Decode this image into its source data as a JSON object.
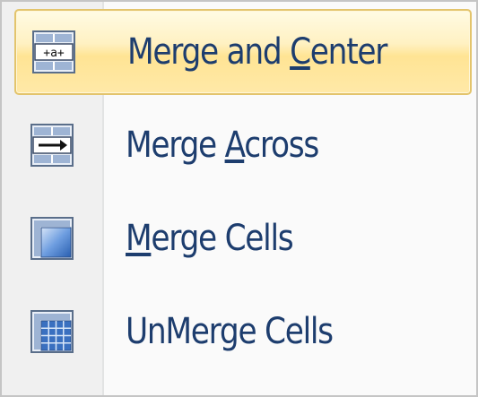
{
  "menu": {
    "items": [
      {
        "id": "merge-and-center",
        "pre": "Merge and ",
        "accel": "C",
        "post": "enter",
        "icon": "merge-and-center-icon",
        "highlighted": true
      },
      {
        "id": "merge-across",
        "pre": "Merge ",
        "accel": "A",
        "post": "cross",
        "icon": "merge-across-icon",
        "highlighted": false
      },
      {
        "id": "merge-cells",
        "pre": "",
        "accel": "M",
        "post": "erge Cells",
        "icon": "merge-cells-icon",
        "highlighted": false
      },
      {
        "id": "unmerge-cells",
        "pre": "UnMerge Cells",
        "accel": "",
        "post": "",
        "icon": "unmerge-cells-icon",
        "highlighted": false
      }
    ],
    "icon_glyph_text": "+a+"
  },
  "colors": {
    "label_text": "#1d3d6e",
    "hover_border": "#e3c46c",
    "hover_fill": "#ffe494",
    "gutter": "#f0f0f0",
    "icon_blue": "#3a70c0"
  }
}
